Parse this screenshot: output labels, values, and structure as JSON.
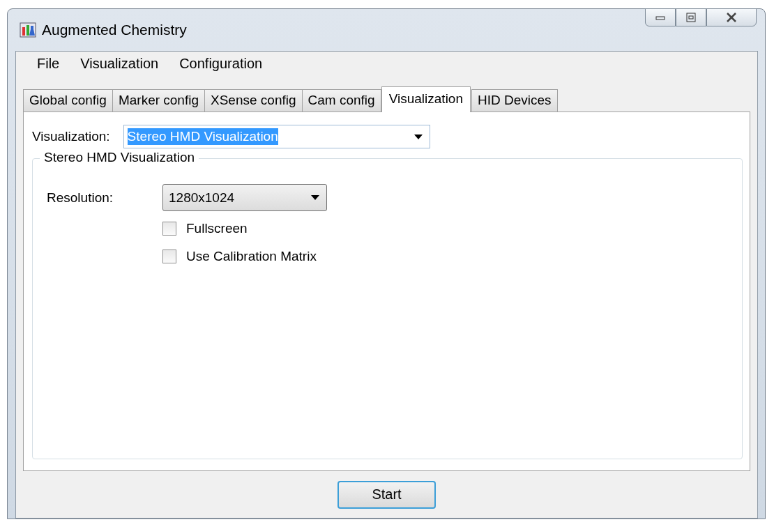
{
  "window": {
    "title": "Augmented Chemistry"
  },
  "menu": [
    "File",
    "Visualization",
    "Configuration"
  ],
  "tabs": [
    {
      "label": "Global config",
      "selected": false
    },
    {
      "label": "Marker config",
      "selected": false
    },
    {
      "label": "XSense config",
      "selected": false
    },
    {
      "label": "Cam config",
      "selected": false
    },
    {
      "label": "Visualization",
      "selected": true
    },
    {
      "label": "HID Devices",
      "selected": false
    }
  ],
  "visualization": {
    "label": "Visualization:",
    "value": "Stereo HMD Visualization"
  },
  "group": {
    "title": "Stereo HMD Visualization",
    "resolution": {
      "label": "Resolution:",
      "value": "1280x1024"
    },
    "options": [
      {
        "label": "Fullscreen",
        "checked": false
      },
      {
        "label": "Use Calibration Matrix",
        "checked": false
      }
    ]
  },
  "buttons": [
    "Start"
  ]
}
